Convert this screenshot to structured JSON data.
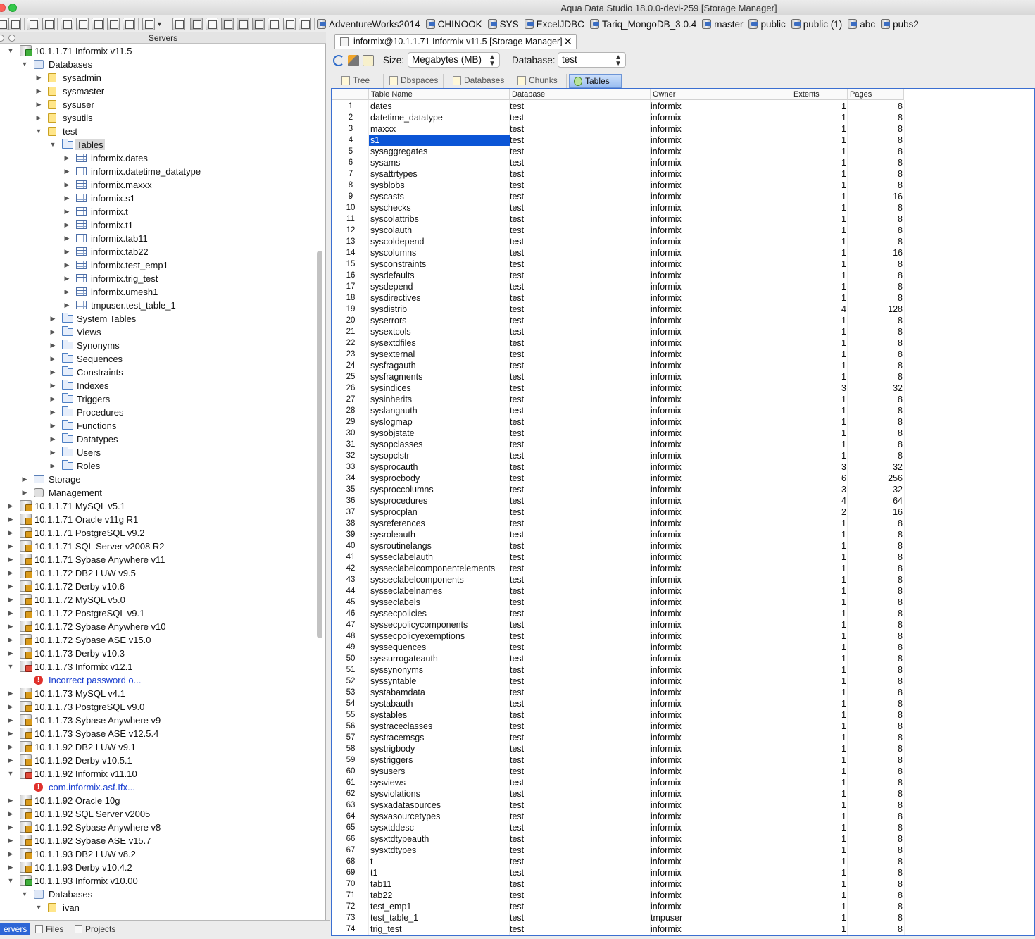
{
  "window": {
    "title": "Aqua Data Studio 18.0.0-devi-259 [Storage Manager]"
  },
  "bookmarks": [
    "AdventureWorks2014",
    "CHINOOK",
    "SYS",
    "ExcelJDBC",
    "Tariq_MongoDB_3.0.4",
    "master",
    "public",
    "public (1)",
    "abc",
    "pubs2"
  ],
  "servers_panel": {
    "title": "Servers"
  },
  "tree": [
    {
      "label": "10.1.1.71 Informix v11.5",
      "depth": 0,
      "arrow": "open",
      "icon": "server-ok"
    },
    {
      "label": "Databases",
      "depth": 1,
      "arrow": "open",
      "icon": "databases"
    },
    {
      "label": "sysadmin",
      "depth": 2,
      "arrow": "closed",
      "icon": "db-folder"
    },
    {
      "label": "sysmaster",
      "depth": 2,
      "arrow": "closed",
      "icon": "db-folder"
    },
    {
      "label": "sysuser",
      "depth": 2,
      "arrow": "closed",
      "icon": "db-folder"
    },
    {
      "label": "sysutils",
      "depth": 2,
      "arrow": "closed",
      "icon": "db-folder"
    },
    {
      "label": "test",
      "depth": 2,
      "arrow": "open",
      "icon": "db-folder"
    },
    {
      "label": "Tables",
      "depth": 3,
      "arrow": "open",
      "icon": "folder",
      "selected": true
    },
    {
      "label": "informix.dates",
      "depth": 4,
      "arrow": "closed",
      "icon": "table"
    },
    {
      "label": "informix.datetime_datatype",
      "depth": 4,
      "arrow": "closed",
      "icon": "table"
    },
    {
      "label": "informix.maxxx",
      "depth": 4,
      "arrow": "closed",
      "icon": "table"
    },
    {
      "label": "informix.s1",
      "depth": 4,
      "arrow": "closed",
      "icon": "table"
    },
    {
      "label": "informix.t",
      "depth": 4,
      "arrow": "closed",
      "icon": "table"
    },
    {
      "label": "informix.t1",
      "depth": 4,
      "arrow": "closed",
      "icon": "table"
    },
    {
      "label": "informix.tab11",
      "depth": 4,
      "arrow": "closed",
      "icon": "table"
    },
    {
      "label": "informix.tab22",
      "depth": 4,
      "arrow": "closed",
      "icon": "table"
    },
    {
      "label": "informix.test_emp1",
      "depth": 4,
      "arrow": "closed",
      "icon": "table"
    },
    {
      "label": "informix.trig_test",
      "depth": 4,
      "arrow": "closed",
      "icon": "table"
    },
    {
      "label": "informix.umesh1",
      "depth": 4,
      "arrow": "closed",
      "icon": "table"
    },
    {
      "label": "tmpuser.test_table_1",
      "depth": 4,
      "arrow": "closed",
      "icon": "table"
    },
    {
      "label": "System Tables",
      "depth": 3,
      "arrow": "closed",
      "icon": "folder"
    },
    {
      "label": "Views",
      "depth": 3,
      "arrow": "closed",
      "icon": "folder"
    },
    {
      "label": "Synonyms",
      "depth": 3,
      "arrow": "closed",
      "icon": "folder"
    },
    {
      "label": "Sequences",
      "depth": 3,
      "arrow": "closed",
      "icon": "folder"
    },
    {
      "label": "Constraints",
      "depth": 3,
      "arrow": "closed",
      "icon": "folder"
    },
    {
      "label": "Indexes",
      "depth": 3,
      "arrow": "closed",
      "icon": "folder"
    },
    {
      "label": "Triggers",
      "depth": 3,
      "arrow": "closed",
      "icon": "folder"
    },
    {
      "label": "Procedures",
      "depth": 3,
      "arrow": "closed",
      "icon": "folder"
    },
    {
      "label": "Functions",
      "depth": 3,
      "arrow": "closed",
      "icon": "folder"
    },
    {
      "label": "Datatypes",
      "depth": 3,
      "arrow": "closed",
      "icon": "folder"
    },
    {
      "label": "Users",
      "depth": 3,
      "arrow": "closed",
      "icon": "folder"
    },
    {
      "label": "Roles",
      "depth": 3,
      "arrow": "closed",
      "icon": "folder"
    },
    {
      "label": "Storage",
      "depth": 1,
      "arrow": "closed",
      "icon": "storage"
    },
    {
      "label": "Management",
      "depth": 1,
      "arrow": "closed",
      "icon": "management"
    },
    {
      "label": "10.1.1.71 MySQL v5.1",
      "depth": 0,
      "arrow": "closed",
      "icon": "server"
    },
    {
      "label": "10.1.1.71 Oracle  v11g R1",
      "depth": 0,
      "arrow": "closed",
      "icon": "server"
    },
    {
      "label": "10.1.1.71 PostgreSQL  v9.2",
      "depth": 0,
      "arrow": "closed",
      "icon": "server"
    },
    {
      "label": "10.1.1.71 SQL Server v2008 R2",
      "depth": 0,
      "arrow": "closed",
      "icon": "server"
    },
    {
      "label": "10.1.1.71 Sybase Anywhere v11",
      "depth": 0,
      "arrow": "closed",
      "icon": "server"
    },
    {
      "label": "10.1.1.72 DB2 LUW v9.5",
      "depth": 0,
      "arrow": "closed",
      "icon": "server"
    },
    {
      "label": "10.1.1.72 Derby v10.6",
      "depth": 0,
      "arrow": "closed",
      "icon": "server"
    },
    {
      "label": "10.1.1.72 MySQL v5.0",
      "depth": 0,
      "arrow": "closed",
      "icon": "server"
    },
    {
      "label": "10.1.1.72 PostgreSQL  v9.1",
      "depth": 0,
      "arrow": "closed",
      "icon": "server"
    },
    {
      "label": "10.1.1.72 Sybase Anywhere v10",
      "depth": 0,
      "arrow": "closed",
      "icon": "server"
    },
    {
      "label": "10.1.1.72 Sybase ASE v15.0",
      "depth": 0,
      "arrow": "closed",
      "icon": "server"
    },
    {
      "label": "10.1.1.73 Derby v10.3",
      "depth": 0,
      "arrow": "closed",
      "icon": "server"
    },
    {
      "label": "10.1.1.73 Informix v12.1",
      "depth": 0,
      "arrow": "open",
      "icon": "server-bad"
    },
    {
      "label": "Incorrect password o...",
      "depth": 1,
      "arrow": "none",
      "icon": "error",
      "error": true
    },
    {
      "label": "10.1.1.73 MySQL v4.1",
      "depth": 0,
      "arrow": "closed",
      "icon": "server"
    },
    {
      "label": "10.1.1.73 PostgreSQL  v9.0",
      "depth": 0,
      "arrow": "closed",
      "icon": "server"
    },
    {
      "label": "10.1.1.73 Sybase Anywhere v9",
      "depth": 0,
      "arrow": "closed",
      "icon": "server"
    },
    {
      "label": "10.1.1.73 Sybase ASE v12.5.4",
      "depth": 0,
      "arrow": "closed",
      "icon": "server"
    },
    {
      "label": "10.1.1.92 DB2 LUW v9.1",
      "depth": 0,
      "arrow": "closed",
      "icon": "server"
    },
    {
      "label": "10.1.1.92 Derby v10.5.1",
      "depth": 0,
      "arrow": "closed",
      "icon": "server"
    },
    {
      "label": "10.1.1.92 Informix v11.10",
      "depth": 0,
      "arrow": "open",
      "icon": "server-bad"
    },
    {
      "label": "com.informix.asf.Ifx...",
      "depth": 1,
      "arrow": "none",
      "icon": "error",
      "error": true
    },
    {
      "label": "10.1.1.92 Oracle 10g",
      "depth": 0,
      "arrow": "closed",
      "icon": "server"
    },
    {
      "label": "10.1.1.92 SQL Server v2005",
      "depth": 0,
      "arrow": "closed",
      "icon": "server"
    },
    {
      "label": "10.1.1.92 Sybase Anywhere v8",
      "depth": 0,
      "arrow": "closed",
      "icon": "server"
    },
    {
      "label": "10.1.1.92 Sybase ASE v15.7",
      "depth": 0,
      "arrow": "closed",
      "icon": "server"
    },
    {
      "label": "10.1.1.93 DB2 LUW v8.2",
      "depth": 0,
      "arrow": "closed",
      "icon": "server"
    },
    {
      "label": "10.1.1.93 Derby v10.4.2",
      "depth": 0,
      "arrow": "closed",
      "icon": "server"
    },
    {
      "label": "10.1.1.93 Informix v10.00",
      "depth": 0,
      "arrow": "open",
      "icon": "server-ok"
    },
    {
      "label": "Databases",
      "depth": 1,
      "arrow": "open",
      "icon": "databases"
    },
    {
      "label": "ivan",
      "depth": 2,
      "arrow": "open",
      "icon": "db-folder"
    }
  ],
  "bottom_tabs": [
    {
      "label": "ervers",
      "active": true
    },
    {
      "label": "Files",
      "active": false
    },
    {
      "label": "Projects",
      "active": false
    }
  ],
  "doc_tab": {
    "title": "informix@10.1.1.71 Informix v11.5 [Storage Manager]",
    "close": "✕"
  },
  "controls": {
    "size_label": "Size:",
    "size_value": "Megabytes (MB)",
    "database_label": "Database:",
    "database_value": "test"
  },
  "sub_tabs": [
    {
      "label": "Tree",
      "active": false
    },
    {
      "label": "Dbspaces",
      "active": false
    },
    {
      "label": "Databases",
      "active": false
    },
    {
      "label": "Chunks",
      "active": false
    },
    {
      "label": "Tables",
      "active": true
    }
  ],
  "grid": {
    "columns": [
      "",
      "Table Name",
      "Database",
      "Owner",
      "Extents",
      "Pages"
    ],
    "selected_row": 4,
    "rows": [
      [
        "1",
        "dates",
        "test",
        "informix",
        "1",
        "8"
      ],
      [
        "2",
        "datetime_datatype",
        "test",
        "informix",
        "1",
        "8"
      ],
      [
        "3",
        "maxxx",
        "test",
        "informix",
        "1",
        "8"
      ],
      [
        "4",
        "s1",
        "test",
        "informix",
        "1",
        "8"
      ],
      [
        "5",
        "sysaggregates",
        "test",
        "informix",
        "1",
        "8"
      ],
      [
        "6",
        "sysams",
        "test",
        "informix",
        "1",
        "8"
      ],
      [
        "7",
        "sysattrtypes",
        "test",
        "informix",
        "1",
        "8"
      ],
      [
        "8",
        "sysblobs",
        "test",
        "informix",
        "1",
        "8"
      ],
      [
        "9",
        "syscasts",
        "test",
        "informix",
        "1",
        "16"
      ],
      [
        "10",
        "syschecks",
        "test",
        "informix",
        "1",
        "8"
      ],
      [
        "11",
        "syscolattribs",
        "test",
        "informix",
        "1",
        "8"
      ],
      [
        "12",
        "syscolauth",
        "test",
        "informix",
        "1",
        "8"
      ],
      [
        "13",
        "syscoldepend",
        "test",
        "informix",
        "1",
        "8"
      ],
      [
        "14",
        "syscolumns",
        "test",
        "informix",
        "1",
        "16"
      ],
      [
        "15",
        "sysconstraints",
        "test",
        "informix",
        "1",
        "8"
      ],
      [
        "16",
        "sysdefaults",
        "test",
        "informix",
        "1",
        "8"
      ],
      [
        "17",
        "sysdepend",
        "test",
        "informix",
        "1",
        "8"
      ],
      [
        "18",
        "sysdirectives",
        "test",
        "informix",
        "1",
        "8"
      ],
      [
        "19",
        "sysdistrib",
        "test",
        "informix",
        "4",
        "128"
      ],
      [
        "20",
        "syserrors",
        "test",
        "informix",
        "1",
        "8"
      ],
      [
        "21",
        "sysextcols",
        "test",
        "informix",
        "1",
        "8"
      ],
      [
        "22",
        "sysextdfiles",
        "test",
        "informix",
        "1",
        "8"
      ],
      [
        "23",
        "sysexternal",
        "test",
        "informix",
        "1",
        "8"
      ],
      [
        "24",
        "sysfragauth",
        "test",
        "informix",
        "1",
        "8"
      ],
      [
        "25",
        "sysfragments",
        "test",
        "informix",
        "1",
        "8"
      ],
      [
        "26",
        "sysindices",
        "test",
        "informix",
        "3",
        "32"
      ],
      [
        "27",
        "sysinherits",
        "test",
        "informix",
        "1",
        "8"
      ],
      [
        "28",
        "syslangauth",
        "test",
        "informix",
        "1",
        "8"
      ],
      [
        "29",
        "syslogmap",
        "test",
        "informix",
        "1",
        "8"
      ],
      [
        "30",
        "sysobjstate",
        "test",
        "informix",
        "1",
        "8"
      ],
      [
        "31",
        "sysopclasses",
        "test",
        "informix",
        "1",
        "8"
      ],
      [
        "32",
        "sysopclstr",
        "test",
        "informix",
        "1",
        "8"
      ],
      [
        "33",
        "sysprocauth",
        "test",
        "informix",
        "3",
        "32"
      ],
      [
        "34",
        "sysprocbody",
        "test",
        "informix",
        "6",
        "256"
      ],
      [
        "35",
        "sysproccolumns",
        "test",
        "informix",
        "3",
        "32"
      ],
      [
        "36",
        "sysprocedures",
        "test",
        "informix",
        "4",
        "64"
      ],
      [
        "37",
        "sysprocplan",
        "test",
        "informix",
        "2",
        "16"
      ],
      [
        "38",
        "sysreferences",
        "test",
        "informix",
        "1",
        "8"
      ],
      [
        "39",
        "sysroleauth",
        "test",
        "informix",
        "1",
        "8"
      ],
      [
        "40",
        "sysroutinelangs",
        "test",
        "informix",
        "1",
        "8"
      ],
      [
        "41",
        "sysseclabelauth",
        "test",
        "informix",
        "1",
        "8"
      ],
      [
        "42",
        "sysseclabelcomponentelements",
        "test",
        "informix",
        "1",
        "8"
      ],
      [
        "43",
        "sysseclabelcomponents",
        "test",
        "informix",
        "1",
        "8"
      ],
      [
        "44",
        "sysseclabelnames",
        "test",
        "informix",
        "1",
        "8"
      ],
      [
        "45",
        "sysseclabels",
        "test",
        "informix",
        "1",
        "8"
      ],
      [
        "46",
        "syssecpolicies",
        "test",
        "informix",
        "1",
        "8"
      ],
      [
        "47",
        "syssecpolicycomponents",
        "test",
        "informix",
        "1",
        "8"
      ],
      [
        "48",
        "syssecpolicyexemptions",
        "test",
        "informix",
        "1",
        "8"
      ],
      [
        "49",
        "syssequences",
        "test",
        "informix",
        "1",
        "8"
      ],
      [
        "50",
        "syssurrogateauth",
        "test",
        "informix",
        "1",
        "8"
      ],
      [
        "51",
        "syssynonyms",
        "test",
        "informix",
        "1",
        "8"
      ],
      [
        "52",
        "syssyntable",
        "test",
        "informix",
        "1",
        "8"
      ],
      [
        "53",
        "systabamdata",
        "test",
        "informix",
        "1",
        "8"
      ],
      [
        "54",
        "systabauth",
        "test",
        "informix",
        "1",
        "8"
      ],
      [
        "55",
        "systables",
        "test",
        "informix",
        "1",
        "8"
      ],
      [
        "56",
        "systraceclasses",
        "test",
        "informix",
        "1",
        "8"
      ],
      [
        "57",
        "systracemsgs",
        "test",
        "informix",
        "1",
        "8"
      ],
      [
        "58",
        "systrigbody",
        "test",
        "informix",
        "1",
        "8"
      ],
      [
        "59",
        "systriggers",
        "test",
        "informix",
        "1",
        "8"
      ],
      [
        "60",
        "sysusers",
        "test",
        "informix",
        "1",
        "8"
      ],
      [
        "61",
        "sysviews",
        "test",
        "informix",
        "1",
        "8"
      ],
      [
        "62",
        "sysviolations",
        "test",
        "informix",
        "1",
        "8"
      ],
      [
        "63",
        "sysxadatasources",
        "test",
        "informix",
        "1",
        "8"
      ],
      [
        "64",
        "sysxasourcetypes",
        "test",
        "informix",
        "1",
        "8"
      ],
      [
        "65",
        "sysxtddesc",
        "test",
        "informix",
        "1",
        "8"
      ],
      [
        "66",
        "sysxtdtypeauth",
        "test",
        "informix",
        "1",
        "8"
      ],
      [
        "67",
        "sysxtdtypes",
        "test",
        "informix",
        "1",
        "8"
      ],
      [
        "68",
        "t",
        "test",
        "informix",
        "1",
        "8"
      ],
      [
        "69",
        "t1",
        "test",
        "informix",
        "1",
        "8"
      ],
      [
        "70",
        "tab11",
        "test",
        "informix",
        "1",
        "8"
      ],
      [
        "71",
        "tab22",
        "test",
        "informix",
        "1",
        "8"
      ],
      [
        "72",
        "test_emp1",
        "test",
        "informix",
        "1",
        "8"
      ],
      [
        "73",
        "test_table_1",
        "test",
        "tmpuser",
        "1",
        "8"
      ],
      [
        "74",
        "trig_test",
        "test",
        "informix",
        "1",
        "8"
      ]
    ]
  }
}
